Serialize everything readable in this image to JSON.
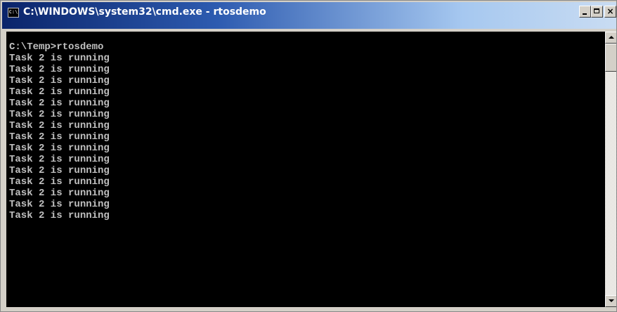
{
  "window": {
    "title": "C:\\WINDOWS\\system32\\cmd.exe - rtosdemo",
    "icon_text": "C:\\",
    "buttons": {
      "minimize": "",
      "maximize": "",
      "close": "×"
    }
  },
  "console": {
    "lines": [
      "C:\\Temp>rtosdemo",
      "Task 2 is running",
      "Task 2 is running",
      "Task 2 is running",
      "Task 2 is running",
      "Task 2 is running",
      "Task 2 is running",
      "Task 2 is running",
      "Task 2 is running",
      "Task 2 is running",
      "Task 2 is running",
      "Task 2 is running",
      "Task 2 is running",
      "Task 2 is running",
      "Task 2 is running",
      "Task 2 is running"
    ],
    "text_color": "#c0c0c0",
    "background": "#000000"
  },
  "scrollbar": {
    "up_icon": "arrow-up",
    "down_icon": "arrow-down"
  }
}
